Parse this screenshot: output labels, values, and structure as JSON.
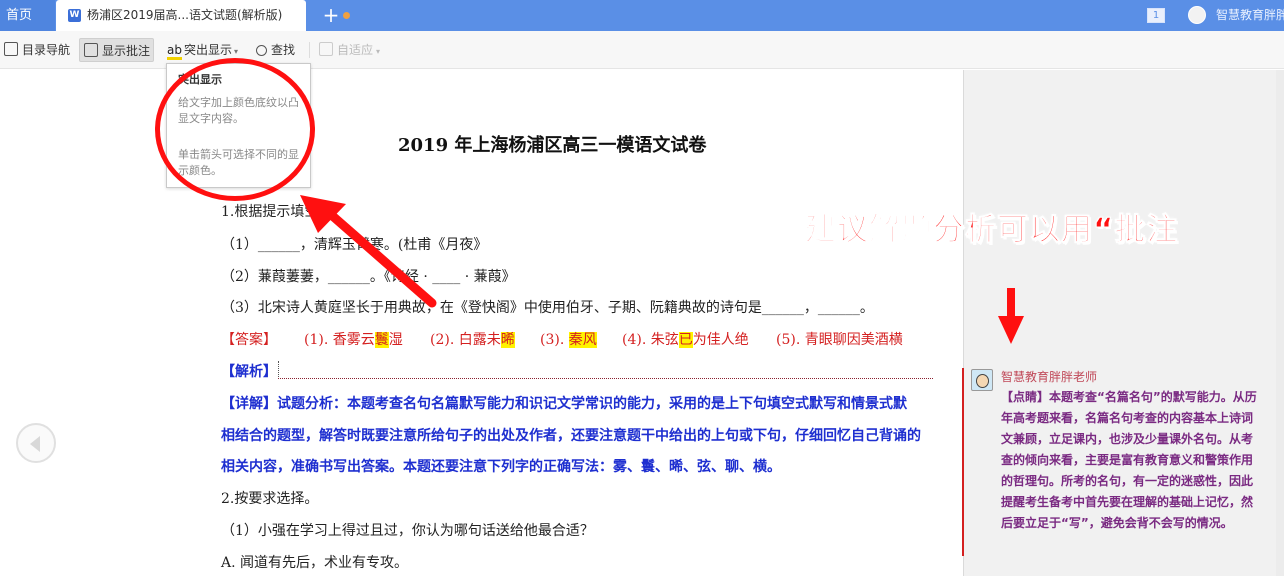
{
  "tabs": {
    "home_label": "首页",
    "doc_title": "杨浦区2019届高...语文试题(解析版)",
    "add_symbol": "+"
  },
  "window": {
    "count_badge": "1",
    "user_name": "智慧教育胖胖老"
  },
  "toolbar": {
    "outline_label": "目录导航",
    "comments_label": "显示批注",
    "highlight_icon_text": "ab",
    "highlight_label": "突出显示",
    "find_label": "查找",
    "fit_label": "自适应"
  },
  "tooltip": {
    "title": "突出显示",
    "para1": "给文字加上颜色底纹以凸显文字内容。",
    "para2": "单击箭头可选择不同的显示颜色。"
  },
  "document": {
    "title": "2019 年上海杨浦区高三一模语文试卷",
    "q1_prompt": "1.根据提示填空",
    "q1_1": "（1）______，清辉玉臂寒。(杜甫《月夜》",
    "q1_2": "（2）蒹葭萋萋，______。《诗经 · ____ · 蒹葭》",
    "q1_3": "（3）北宋诗人黄庭坚长于用典故，在《登快阁》中使用伯牙、子期、阮籍典故的诗句是______，______。",
    "answer_label": "【答案】",
    "answers": [
      {
        "pre": "(1). 香雾云",
        "hl": "鬟",
        "post": "湿"
      },
      {
        "pre": "(2). 白露未",
        "hl": "晞",
        "post": ""
      },
      {
        "pre": "(3). ",
        "hl": "秦风",
        "post": ""
      },
      {
        "pre": "(4). 朱弦",
        "hl": "已",
        "post": "为佳人绝"
      },
      {
        "pre": "(5). 青眼聊因美酒横",
        "hl": "",
        "post": ""
      }
    ],
    "analysis_label": "【解析】",
    "detail_1": "【详解】试题分析：本题考查名句名篇默写能力和识记文学常识的能力，采用的是上下句填空式默写和情景式默",
    "detail_2": "相结合的题型，解答时既要注意所给句子的出处及作者，还要注意题干中给出的上句或下句，仔细回忆自己背诵的",
    "detail_3": "相关内容，准确书写出答案。本题还要注意下列字的正确写法：雾、鬟、晞、弦、聊、横。",
    "q2_prompt": "2.按要求选择。",
    "q2_1": "（1）小强在学习上得过且过，你认为哪句话送给他最合适？",
    "q2_A": "A. 闻道有先后，术业有专攻。"
  },
  "overlay_text": "建议解题分析可以用“批注",
  "comment": {
    "author": "智慧教育胖胖老师",
    "text": "【点睛】本题考查“名篇名句”的默写能力。从历年高考题来看，名篇名句考查的内容基本上诗词文兼顾，立足课内，也涉及少量课外名句。从考查的倾向来看，主要是富有教育意义和警策作用的哲理句。所考的名句，有一定的迷惑性，因此提醒考生备考中首先要在理解的基础上记忆，然后要立足于“写”，避免会背不会写的情况。"
  },
  "colors": {
    "tabbar": "#5a8fe6",
    "answer_red": "#d42020",
    "analysis_blue": "#1e2fd0",
    "annotation_red": "#ff1010",
    "comment_purple": "#7a2a82",
    "highlight": "#fff200"
  }
}
